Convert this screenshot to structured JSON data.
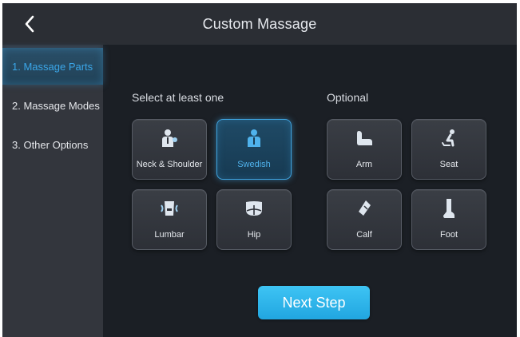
{
  "header": {
    "title": "Custom Massage",
    "back_icon": "chevron-left-icon"
  },
  "sidebar": {
    "items": [
      {
        "label": "1. Massage Parts",
        "active": true
      },
      {
        "label": "2. Massage Modes",
        "active": false
      },
      {
        "label": "3. Other Options",
        "active": false
      }
    ]
  },
  "main": {
    "required_label": "Select at least one",
    "optional_label": "Optional",
    "required_parts": [
      {
        "label": "Neck & Shoulder",
        "icon": "neck-shoulder-icon",
        "selected": false
      },
      {
        "label": "Swedish",
        "icon": "swedish-icon",
        "selected": true
      },
      {
        "label": "Lumbar",
        "icon": "lumbar-icon",
        "selected": false
      },
      {
        "label": "Hip",
        "icon": "hip-icon",
        "selected": false
      }
    ],
    "optional_parts": [
      {
        "label": "Arm",
        "icon": "arm-icon",
        "selected": false
      },
      {
        "label": "Seat",
        "icon": "seat-icon",
        "selected": false
      },
      {
        "label": "Calf",
        "icon": "calf-icon",
        "selected": false
      },
      {
        "label": "Foot",
        "icon": "foot-icon",
        "selected": false
      }
    ],
    "next_label": "Next Step"
  },
  "colors": {
    "accent": "#3aa6e8",
    "button": "#2bb3ea",
    "background": "#1b1f25",
    "card": "#33363d"
  }
}
